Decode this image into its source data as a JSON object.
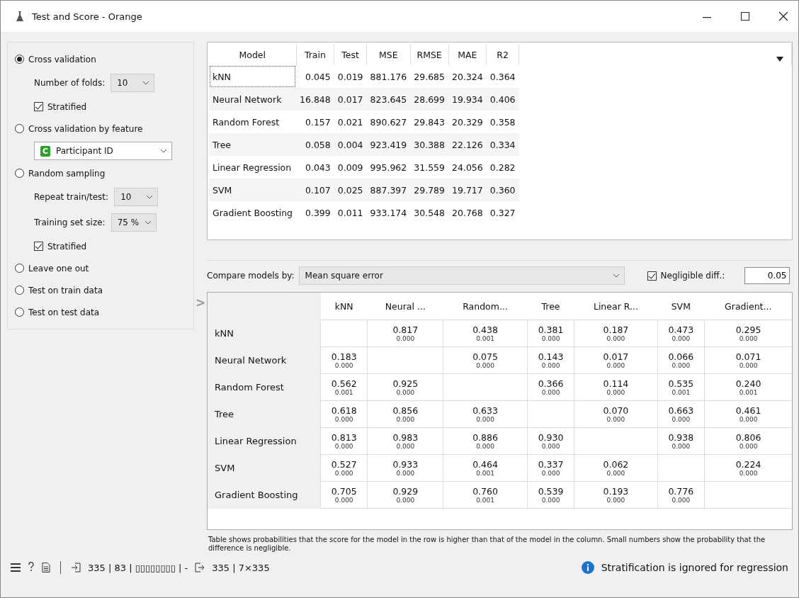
{
  "window": {
    "title": "Test and Score - Orange"
  },
  "sampling": [
    {
      "kind": "radio",
      "label": "Cross validation",
      "selected": true
    },
    {
      "kind": "combo",
      "label": "Number of folds:",
      "value": "10"
    },
    {
      "kind": "checkbox",
      "label": "Stratified",
      "checked": true
    },
    {
      "kind": "radio",
      "label": "Cross validation by feature",
      "selected": false
    },
    {
      "kind": "feature",
      "badge": "C",
      "value": "Participant ID"
    },
    {
      "kind": "radio",
      "label": "Random sampling",
      "selected": false
    },
    {
      "kind": "combo",
      "label": "Repeat train/test:",
      "value": "10"
    },
    {
      "kind": "combo",
      "label": "Training set size:",
      "value": "75 %"
    },
    {
      "kind": "checkbox",
      "label": "Stratified",
      "checked": true
    },
    {
      "kind": "radio",
      "label": "Leave one out",
      "selected": false
    },
    {
      "kind": "radio",
      "label": "Test on train data",
      "selected": false
    },
    {
      "kind": "radio",
      "label": "Test on test data",
      "selected": false
    }
  ],
  "collapse_arrow": ">",
  "scores": {
    "columns": [
      "Model",
      "Train",
      "Test",
      "MSE",
      "RMSE",
      "MAE",
      "R2"
    ],
    "rows": [
      {
        "focused": true,
        "cells": [
          "kNN",
          "0.045",
          "0.019",
          "881.176",
          "29.685",
          "20.324",
          "0.364"
        ]
      },
      {
        "focused": false,
        "cells": [
          "Neural Network",
          "16.848",
          "0.017",
          "823.645",
          "28.699",
          "19.934",
          "0.406"
        ]
      },
      {
        "focused": false,
        "cells": [
          "Random Forest",
          "0.157",
          "0.021",
          "890.627",
          "29.843",
          "20.329",
          "0.358"
        ]
      },
      {
        "focused": false,
        "cells": [
          "Tree",
          "0.058",
          "0.004",
          "923.419",
          "30.388",
          "22.126",
          "0.334"
        ]
      },
      {
        "focused": false,
        "cells": [
          "Linear Regression",
          "0.043",
          "0.009",
          "995.962",
          "31.559",
          "24.056",
          "0.282"
        ]
      },
      {
        "focused": false,
        "cells": [
          "SVM",
          "0.107",
          "0.025",
          "887.397",
          "29.789",
          "19.717",
          "0.360"
        ]
      },
      {
        "focused": false,
        "cells": [
          "Gradient Boosting",
          "0.399",
          "0.011",
          "933.174",
          "30.548",
          "20.768",
          "0.327"
        ]
      }
    ]
  },
  "compare": {
    "label": "Compare models by:",
    "value": "Mean square error",
    "negligible": {
      "label": "Negligible diff.:",
      "checked": true,
      "value": "0.05"
    },
    "columns": [
      "kNN",
      "Neural ...",
      "Random...",
      "Tree",
      "Linear R...",
      "SVM",
      "Gradient..."
    ],
    "rows": [
      {
        "name": "kNN",
        "cells": [
          null,
          [
            "0.817",
            "0.000"
          ],
          [
            "0.438",
            "0.001"
          ],
          [
            "0.381",
            "0.000"
          ],
          [
            "0.187",
            "0.000"
          ],
          [
            "0.473",
            "0.000"
          ],
          [
            "0.295",
            "0.000"
          ]
        ]
      },
      {
        "name": "Neural Network",
        "cells": [
          [
            "0.183",
            "0.000"
          ],
          null,
          [
            "0.075",
            "0.000"
          ],
          [
            "0.143",
            "0.000"
          ],
          [
            "0.017",
            "0.000"
          ],
          [
            "0.066",
            "0.000"
          ],
          [
            "0.071",
            "0.000"
          ]
        ]
      },
      {
        "name": "Random Forest",
        "cells": [
          [
            "0.562",
            "0.001"
          ],
          [
            "0.925",
            "0.000"
          ],
          null,
          [
            "0.366",
            "0.000"
          ],
          [
            "0.114",
            "0.000"
          ],
          [
            "0.535",
            "0.001"
          ],
          [
            "0.240",
            "0.001"
          ]
        ]
      },
      {
        "name": "Tree",
        "cells": [
          [
            "0.618",
            "0.000"
          ],
          [
            "0.856",
            "0.000"
          ],
          [
            "0.633",
            "0.000"
          ],
          null,
          [
            "0.070",
            "0.000"
          ],
          [
            "0.663",
            "0.000"
          ],
          [
            "0.461",
            "0.000"
          ]
        ]
      },
      {
        "name": "Linear Regression",
        "cells": [
          [
            "0.813",
            "0.000"
          ],
          [
            "0.983",
            "0.000"
          ],
          [
            "0.886",
            "0.000"
          ],
          [
            "0.930",
            "0.000"
          ],
          null,
          [
            "0.938",
            "0.000"
          ],
          [
            "0.806",
            "0.000"
          ]
        ]
      },
      {
        "name": "SVM",
        "cells": [
          [
            "0.527",
            "0.000"
          ],
          [
            "0.933",
            "0.000"
          ],
          [
            "0.464",
            "0.001"
          ],
          [
            "0.337",
            "0.000"
          ],
          [
            "0.062",
            "0.000"
          ],
          null,
          [
            "0.224",
            "0.000"
          ]
        ]
      },
      {
        "name": "Gradient Boosting",
        "cells": [
          [
            "0.705",
            "0.000"
          ],
          [
            "0.929",
            "0.000"
          ],
          [
            "0.760",
            "0.001"
          ],
          [
            "0.539",
            "0.000"
          ],
          [
            "0.193",
            "0.000"
          ],
          [
            "0.776",
            "0.000"
          ],
          null
        ]
      }
    ],
    "note": "Table shows probabilities that the score for the model in the row is higher than that of the model in the column. Small numbers show the probability that the difference is negligible."
  },
  "status_bar": {
    "input": "335 | 83 | ▯▯▯▯▯▯▯▯ | -",
    "output": "335 | 7×335",
    "message": "Stratification is ignored for regression"
  }
}
